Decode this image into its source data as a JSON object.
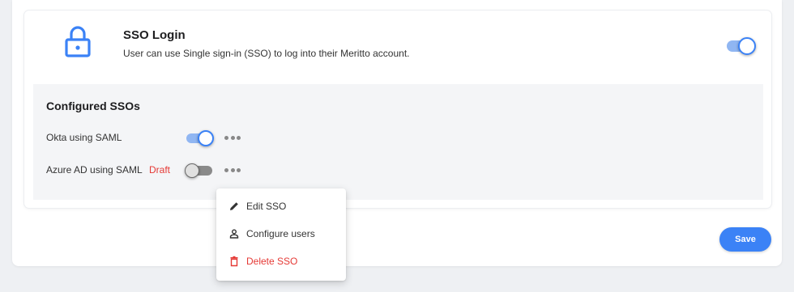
{
  "sso_login": {
    "title": "SSO Login",
    "description": "User can use Single sign-in (SSO) to log into their Meritto account.",
    "enabled": true
  },
  "configured": {
    "title": "Configured SSOs",
    "items": [
      {
        "label": "Okta using SAML",
        "enabled": true,
        "badge": ""
      },
      {
        "label": "Azure AD using SAML",
        "enabled": false,
        "badge": "Draft"
      }
    ]
  },
  "context_menu": {
    "items": [
      {
        "label": "Edit SSO",
        "icon": "pencil-icon"
      },
      {
        "label": "Configure users",
        "icon": "person-icon"
      },
      {
        "label": "Delete SSO",
        "icon": "trash-icon"
      }
    ]
  },
  "footer": {
    "save_label": "Save"
  },
  "colors": {
    "accent": "#3b82f6",
    "danger": "#e53935",
    "panel": "#f4f5f7"
  }
}
